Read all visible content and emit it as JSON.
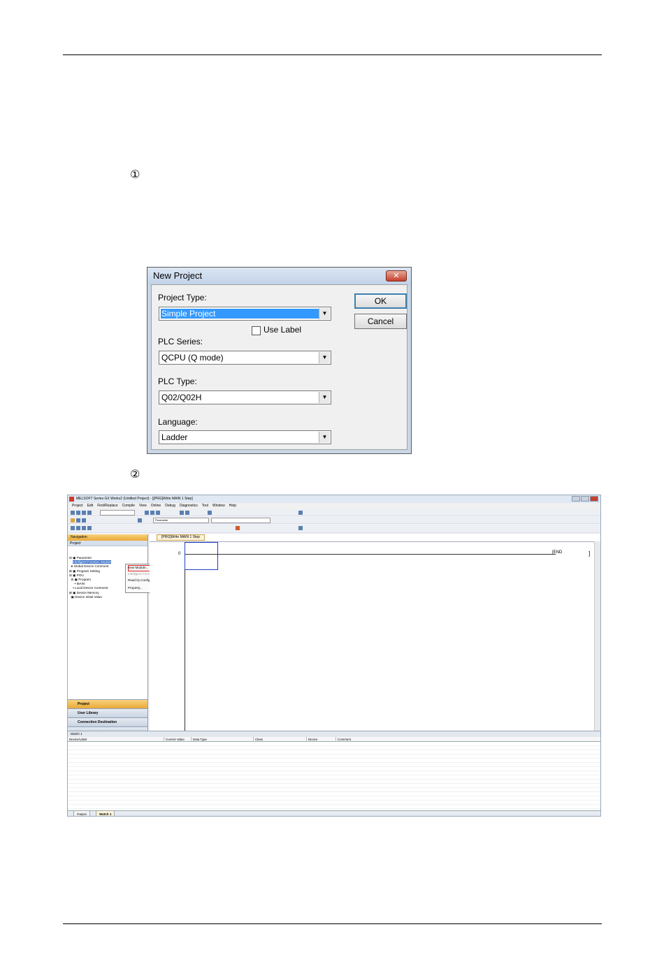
{
  "markers": {
    "step1": "①",
    "step2": "②"
  },
  "dialog": {
    "title": "New Project",
    "close": "✕",
    "project_type_label": "Project Type:",
    "project_type_value": "Simple Project",
    "use_label": "Use Label",
    "use_label_checked": false,
    "plc_series_label": "PLC Series:",
    "plc_series_value": "QCPU (Q mode)",
    "plc_type_label": "PLC Type:",
    "plc_type_value": "Q02/Q02H",
    "language_label": "Language:",
    "language_value": "Ladder",
    "ok": "OK",
    "cancel": "Cancel"
  },
  "ide": {
    "title": "MELSOFT Series GX Works2 (Untitled Project) - [[PRG]Write MAIN 1 Step]",
    "menu": [
      "Project",
      "Edit",
      "Find/Replace",
      "Compile",
      "View",
      "Online",
      "Debug",
      "Diagnostics",
      "Tool",
      "Window",
      "Help"
    ],
    "toolbar_field": "Parameter",
    "nav_header": "Navigation",
    "nav_section": "Project",
    "tree": [
      "Parameter",
      "Intelligent Function Module",
      "Global Device Comment",
      "Program Setting",
      "POU",
      "Program",
      "MAIN",
      "Local Device Comment",
      "Device Memory",
      "Device Initial Value"
    ],
    "context_menu": [
      "New Module...",
      "Intelligent Function Module Parameter List...",
      "Read iQ Configurator-QR Data...",
      "Property..."
    ],
    "nav_tabs": [
      "Project",
      "User Library",
      "Connection Destination"
    ],
    "editor_tab": "[PRG]Write MAIN 1 Step",
    "step_number": "0",
    "end_label": "END",
    "watch_title": "Watch 1",
    "watch_columns": [
      "Device/Label",
      "Current Value",
      "Data Type",
      "Class",
      "Device",
      "Comment"
    ],
    "bottom_tabs": [
      "Output",
      "Watch 1"
    ]
  }
}
